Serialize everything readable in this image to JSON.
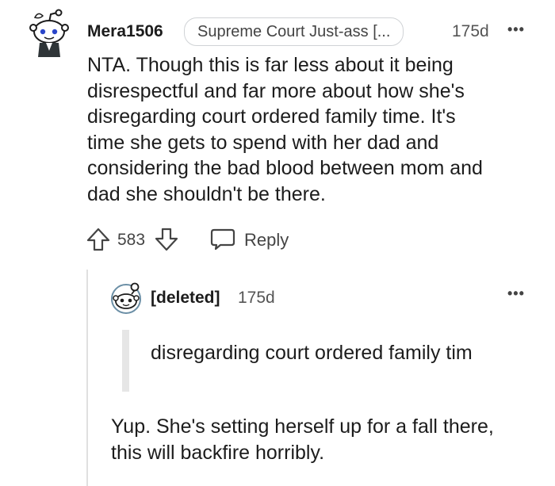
{
  "comment": {
    "author": "Mera1506",
    "flair": "Supreme Court Just-ass [...",
    "age": "175d",
    "more_label": "•••",
    "body_lines": [
      "NTA. Though this is far less about it being",
      "disrespectful and far more about how she's",
      "disregarding court ordered family time. It's",
      "time she gets to spend with her dad and",
      "considering the bad blood between mom and",
      "dad she shouldn't be there."
    ],
    "score": "583",
    "reply_label": "Reply",
    "icons": {
      "avatar": "snoo-avatar-icon",
      "upvote": "upvote-arrow-icon",
      "downvote": "downvote-arrow-icon",
      "reply": "speech-bubble-icon"
    }
  },
  "reply": {
    "author": "[deleted]",
    "age": "175d",
    "more_label": "•••",
    "quote": "disregarding court ordered family tim",
    "body_lines": [
      "Yup. She's setting herself up for a fall there,",
      "this will backfire horribly."
    ],
    "icons": {
      "avatar": "deleted-user-avatar-icon"
    }
  },
  "colors": {
    "text": "#1c1c1c",
    "muted": "#555555",
    "border": "#d0d3d6"
  }
}
